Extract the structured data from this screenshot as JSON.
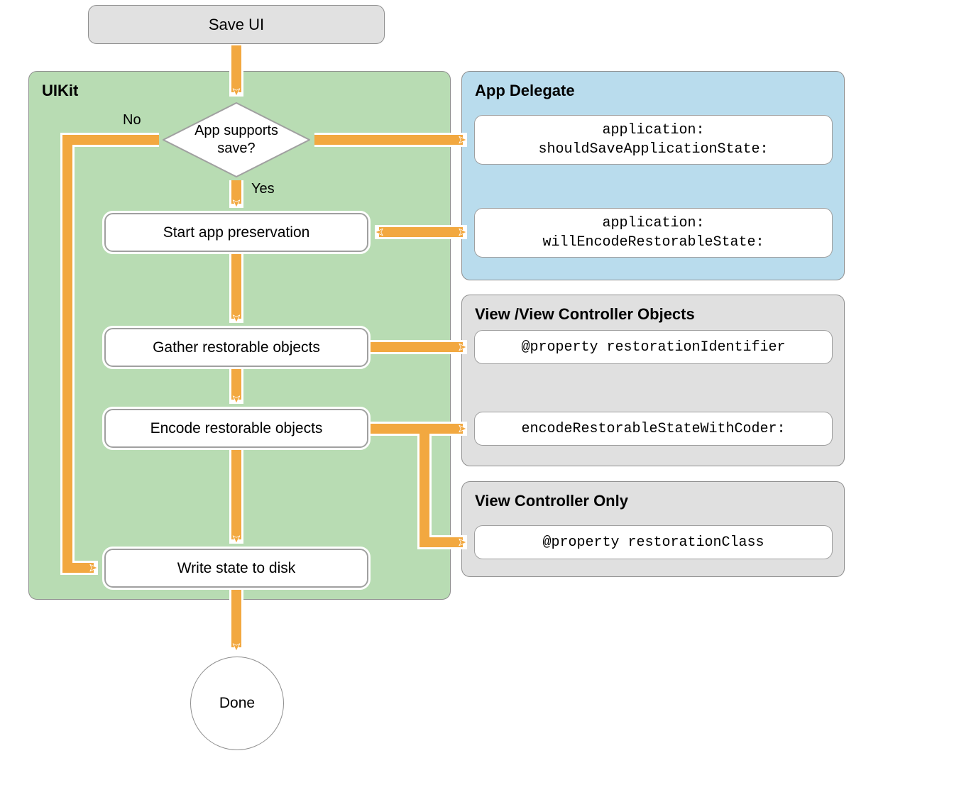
{
  "colors": {
    "arrow_fill": "#f2a840",
    "arrow_outline": "#ffffff",
    "panel_green": "#b8dcb3",
    "panel_blue": "#b9dced",
    "panel_grey": "#e0e0e0",
    "panel_border": "#8f8f8f",
    "box_border": "#a0a0a0"
  },
  "start_label": "Save UI",
  "panels": {
    "uikit": {
      "title": "UIKit"
    },
    "app_delegate": {
      "title": "App Delegate"
    },
    "view_objects": {
      "title": "View /View Controller Objects"
    },
    "vc_only": {
      "title": "View Controller Only"
    }
  },
  "decision": {
    "label": "App supports\nsave?",
    "no": "No",
    "yes": "Yes"
  },
  "steps": {
    "start_preservation": "Start app preservation",
    "gather": "Gather restorable objects",
    "encode": "Encode restorable objects",
    "write_disk": "Write state to disk"
  },
  "callouts": {
    "should_save": "application:\nshouldSaveApplicationState:",
    "will_encode": "application:\nwillEncodeRestorableState:",
    "restoration_id": "@property restorationIdentifier",
    "encode_coder": "encodeRestorableStateWithCoder:",
    "restoration_class": "@property restorationClass"
  },
  "terminator": "Done"
}
